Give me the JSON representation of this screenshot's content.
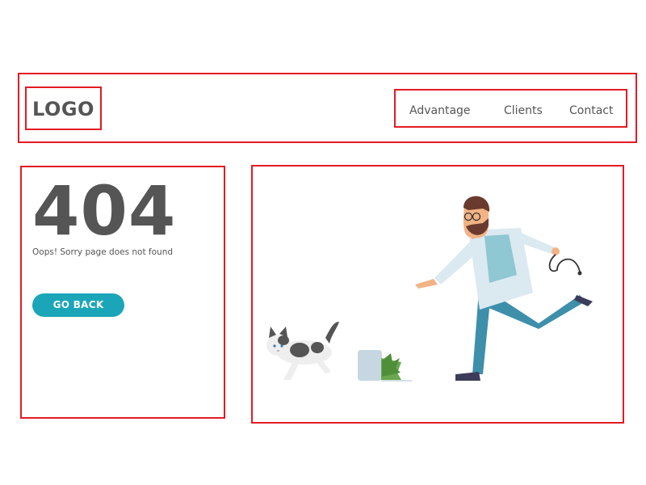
{
  "header": {
    "logo": "LOGO",
    "nav": [
      {
        "label": "Advantage"
      },
      {
        "label": "Clients"
      },
      {
        "label": "Contact"
      }
    ]
  },
  "error": {
    "code": "404",
    "message": "Oops! Sorry page does not found",
    "button_label": "GO BACK"
  },
  "colors": {
    "accent": "#1aa6b8",
    "text": "#555555",
    "outline": "#e31b23"
  },
  "icons": [
    "doctor-figure",
    "cat-figure",
    "fallen-plant-pot"
  ]
}
